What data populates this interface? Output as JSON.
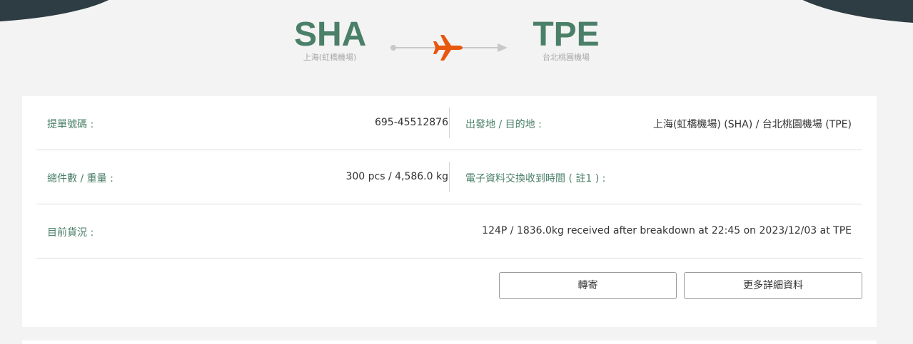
{
  "route": {
    "origin_code": "SHA",
    "origin_name": "上海(虹橋機場)",
    "dest_code": "TPE",
    "dest_name": "台北桃園機場",
    "plane_icon": "airplane-icon",
    "plane_color": "#e8570e",
    "code_color": "#4a7f68"
  },
  "details": {
    "awb_label": "提單號碼 :",
    "awb_value": "695-45512876",
    "od_label": "出發地 / 目的地 :",
    "od_value": "上海(虹橋機場) (SHA) / 台北桃園機場 (TPE)",
    "pieces_label": "總件數 / 重量 :",
    "pieces_value": "300 pcs / 4,586.0 kg",
    "edi_label": "電子資料交換收到時間 ( 註1 ) :",
    "edi_value": "",
    "status_label": "目前貨況 :",
    "status_value": "124P / 1836.0kg received after breakdown at 22:45 on 2023/12/03 at TPE"
  },
  "actions": {
    "forward_label": "轉寄",
    "more_label": "更多詳細資料"
  }
}
